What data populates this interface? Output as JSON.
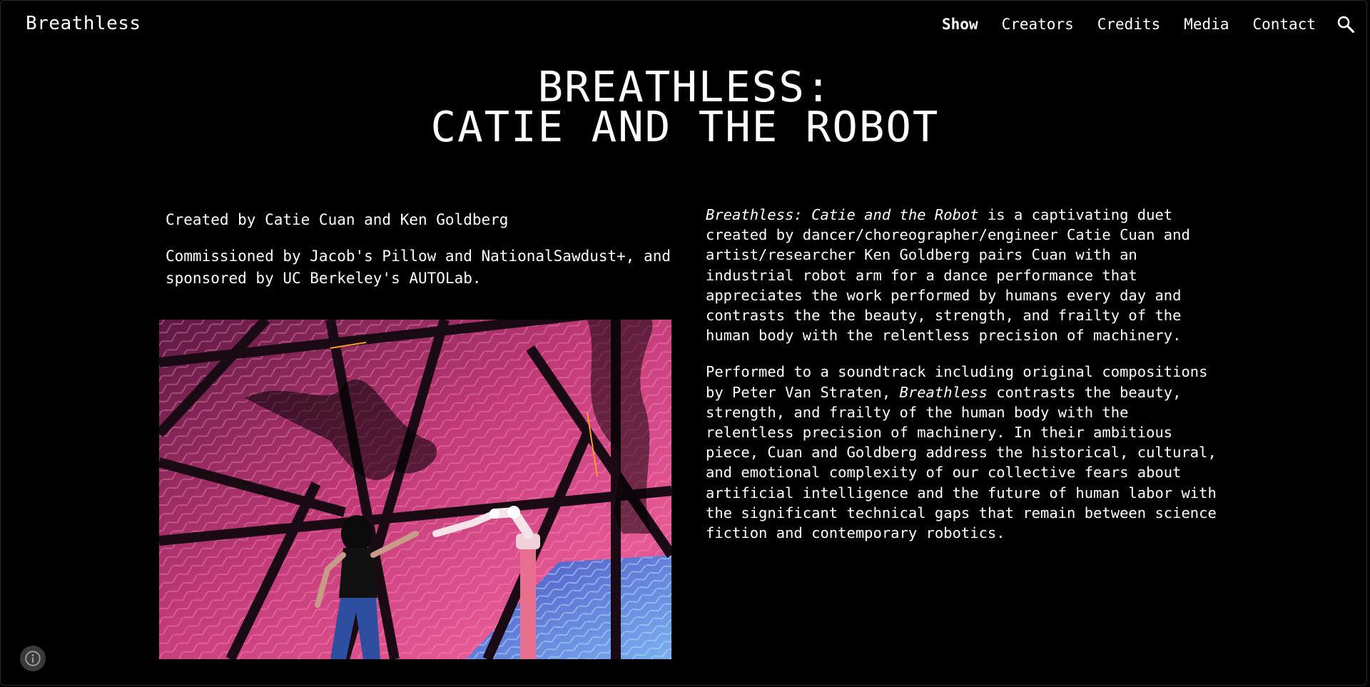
{
  "header": {
    "site_title": "Breathless",
    "nav": [
      {
        "label": "Show",
        "active": true
      },
      {
        "label": "Creators",
        "active": false
      },
      {
        "label": "Credits",
        "active": false
      },
      {
        "label": "Media",
        "active": false
      },
      {
        "label": "Contact",
        "active": false
      }
    ],
    "search_icon": "search-icon"
  },
  "hero": {
    "title_line1": "BREATHLESS:",
    "title_line2": "CATIE AND THE ROBOT"
  },
  "left": {
    "created_by": "Created by Catie Cuan and Ken Goldberg",
    "commissioned": "Commissioned by Jacob's Pillow and NationalSawdust+, and sponsored by UC Berkeley's AUTOLab."
  },
  "right": {
    "p1_italic": "Breathless: Catie and the Robot",
    "p1_rest": " is a captivating duet created by dancer/choreographer/engineer Catie Cuan and artist/researcher Ken Goldberg pairs Cuan with an industrial robot arm for a dance performance that appreciates the work performed by humans every day and contrasts the the beauty, strength, and frailty of the human body with the relentless precision of machinery.",
    "p2_start": "Performed to a soundtrack including original compositions by Peter Van Straten, ",
    "p2_italic": "Breathless",
    "p2_rest": " contrasts the beauty, strength, and frailty of the human body with the relentless precision of machinery. In their ambitious piece, Cuan and Goldberg address the historical, cultural, and emotional complexity of our collective fears about artificial intelligence and the future of human labor with the significant technical gaps that remain between science fiction and contemporary robotics."
  },
  "colors": {
    "background": "#000000",
    "text": "#ffffff",
    "photo_pink": "#e0407a",
    "photo_blue": "#3a6fd8"
  },
  "info_icon": "info-icon"
}
